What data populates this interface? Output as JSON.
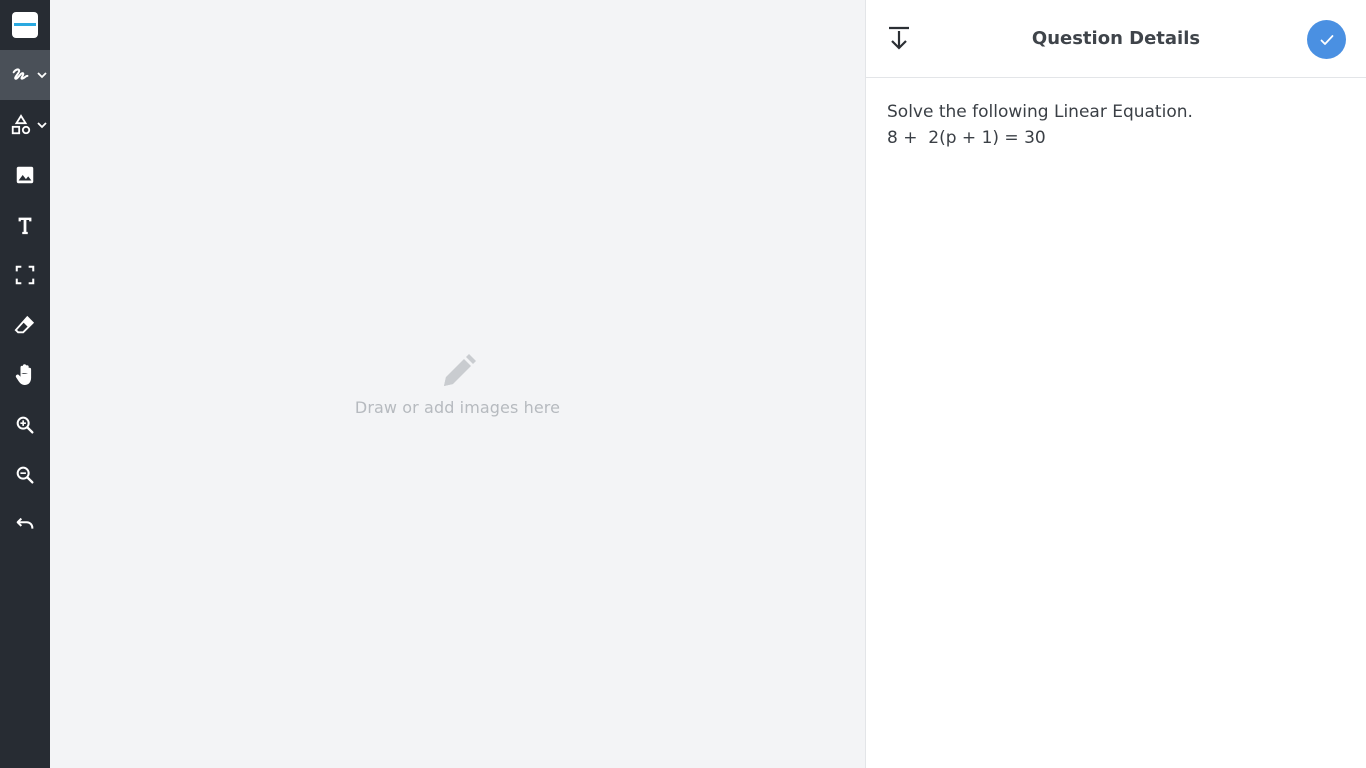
{
  "toolbar": {
    "items": [
      {
        "icon": "logo-icon",
        "has_menu": false
      },
      {
        "icon": "freehand-draw-icon",
        "has_menu": true,
        "active": true
      },
      {
        "icon": "shapes-icon",
        "has_menu": true
      },
      {
        "icon": "image-icon",
        "has_menu": false
      },
      {
        "icon": "text-icon",
        "has_menu": false
      },
      {
        "icon": "fit-screen-icon",
        "has_menu": false
      },
      {
        "icon": "eraser-icon",
        "has_menu": false
      },
      {
        "icon": "hand-pan-icon",
        "has_menu": false
      },
      {
        "icon": "zoom-in-icon",
        "has_menu": false
      },
      {
        "icon": "zoom-out-icon",
        "has_menu": false
      },
      {
        "icon": "undo-icon",
        "has_menu": false
      }
    ],
    "colors": {
      "background": "#272c33",
      "active": "#4a5058",
      "logo_accent": "#2aa9e0"
    }
  },
  "canvas": {
    "placeholder_icon": "pencil-icon",
    "placeholder_text": "Draw or add images here"
  },
  "panel": {
    "title": "Question Details",
    "collapse_icon": "collapse-panel-icon",
    "confirm_icon": "checkmark-icon",
    "confirm_color": "#4a90e2",
    "question": {
      "line1": "Solve the following Linear Equation.",
      "line2": "8 +  2(p + 1) = 30"
    }
  }
}
